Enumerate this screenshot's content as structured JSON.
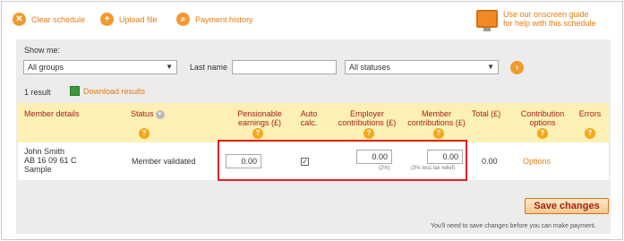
{
  "toolbar": {
    "clear": "Clear schedule",
    "upload": "Upload file",
    "history": "Payment history",
    "guide_line1": "Use our onscreen guide",
    "guide_line2": "for help with this schedule"
  },
  "filters": {
    "show_me": "Show me:",
    "group_selected": "All groups",
    "last_name_label": "Last name",
    "last_name_value": "",
    "status_selected": "All statuses"
  },
  "results": {
    "count": "1 result",
    "download": "Download results"
  },
  "table": {
    "headers": {
      "member": "Member details",
      "status": "Status",
      "pensionable": "Pensionable earnings (£)",
      "auto": "Auto calc.",
      "employer": "Employer contributions (£)",
      "member_contrib": "Member contributions (£)",
      "total": "Total (£)",
      "contribution_options": "Contribution options",
      "errors": "Errors"
    },
    "row": {
      "name": "John Smith",
      "ni": "AB 16 09 61 C",
      "extra": "Sample",
      "status": "Member validated",
      "pensionable": "0.00",
      "auto_checked": true,
      "employer": "0.00",
      "employer_note": "(2%)",
      "member": "0.00",
      "member_note": "(3% less tax relief)",
      "total": "0.00",
      "options": "Options"
    }
  },
  "actions": {
    "save": "Save changes",
    "footnote": "You'll need to save changes before you can make payment."
  },
  "colors": {
    "accent": "#e77c12",
    "header_bg": "#fcf0b4",
    "header_text": "#a6211f",
    "highlight": "#e32027"
  }
}
